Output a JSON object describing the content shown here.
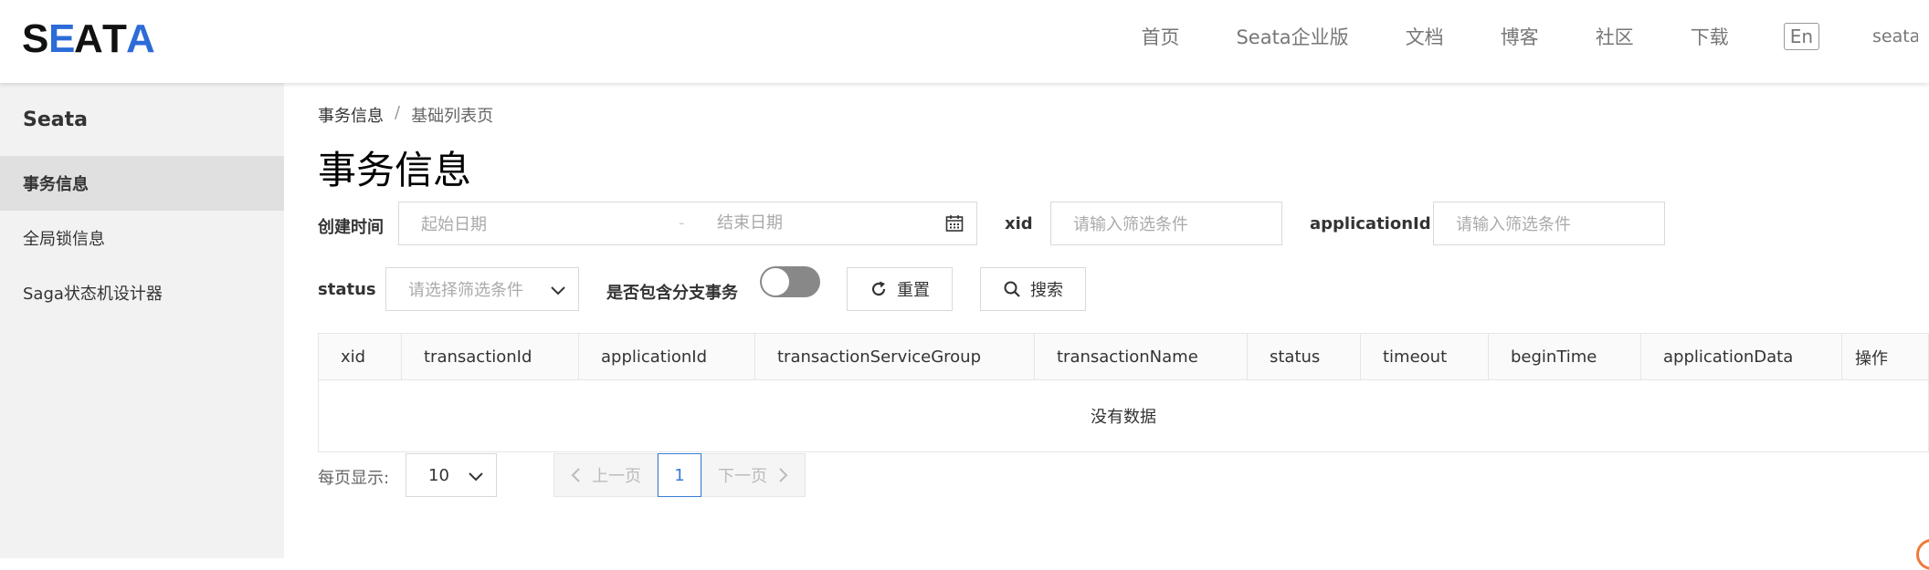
{
  "header": {
    "logo_text": "SEATA",
    "nav": [
      {
        "label": "首页"
      },
      {
        "label": "Seata企业版"
      },
      {
        "label": "文档"
      },
      {
        "label": "博客"
      },
      {
        "label": "社区"
      },
      {
        "label": "下载"
      }
    ],
    "lang_button": "En",
    "user": "seata"
  },
  "sidebar": {
    "title": "Seata",
    "items": [
      {
        "label": "事务信息",
        "active": true
      },
      {
        "label": "全局锁信息"
      },
      {
        "label": "Saga状态机设计器"
      }
    ]
  },
  "breadcrumb": {
    "parent": "事务信息",
    "separator": "/",
    "current": "基础列表页"
  },
  "page_title": "事务信息",
  "filters": {
    "create_time_label": "创建时间",
    "start_placeholder": "起始日期",
    "range_separator": "-",
    "end_placeholder": "结束日期",
    "xid_label": "xid",
    "xid_placeholder": "请输入筛选条件",
    "application_label": "applicationId",
    "application_placeholder": "请输入筛选条件",
    "status_label": "status",
    "status_placeholder": "请选择筛选条件",
    "branch_label": "是否包含分支事务",
    "branch_toggle": false,
    "reset_button": "重置",
    "search_button": "搜索"
  },
  "table": {
    "columns": [
      "xid",
      "transactionId",
      "applicationId",
      "transactionServiceGroup",
      "transactionName",
      "status",
      "timeout",
      "beginTime",
      "applicationData",
      "操作"
    ],
    "empty_text": "没有数据"
  },
  "pagination": {
    "page_size_label": "每页显示:",
    "page_size": "10",
    "prev": "上一页",
    "current_page": "1",
    "next": "下一页"
  },
  "colors": {
    "accent": "#3a7bd5",
    "logo_blue": "#2d6bd8",
    "toggle_off": "#888888"
  }
}
